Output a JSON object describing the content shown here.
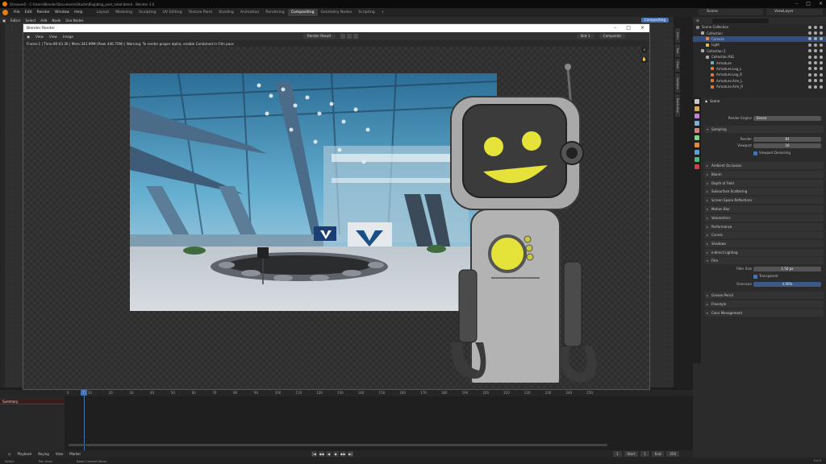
{
  "window": {
    "title": "[Unsaved] - C:\\Users\\Blender\\Documents\\Studio\\Blog\\blog_post_robot.blend - Blender 3.0"
  },
  "topbar": {
    "menus": [
      "File",
      "Edit",
      "Render",
      "Window",
      "Help"
    ],
    "tabs": [
      {
        "label": "Layout",
        "active": false
      },
      {
        "label": "Modeling",
        "active": false
      },
      {
        "label": "Sculpting",
        "active": false
      },
      {
        "label": "UV Editing",
        "active": false
      },
      {
        "label": "Texture Paint",
        "active": false
      },
      {
        "label": "Shading",
        "active": false
      },
      {
        "label": "Animation",
        "active": false
      },
      {
        "label": "Rendering",
        "active": false
      },
      {
        "label": "Compositing",
        "active": true
      },
      {
        "label": "Geometry Nodes",
        "active": false
      },
      {
        "label": "Scripting",
        "active": false
      }
    ],
    "add_tab": "+",
    "scene": "Scene",
    "view_layer": "ViewLayer"
  },
  "node_header": {
    "items": [
      "Editor",
      "Select",
      "Add",
      "Node"
    ],
    "use_nodes": "Use Nodes",
    "right_pill": "Compositing"
  },
  "render_window": {
    "title": "Blender Render",
    "menus": [
      "View",
      "View",
      "Image"
    ],
    "slot": "Render Result",
    "slot_label": "Slot 1",
    "view": "Composite",
    "status": "Frame:1 | Time:00:03.30 | Mem:343.99M (Peak 446.75M) | Warning: To render proper alpha, enable Combined in Film pass",
    "zoom_icon": "zoom-icon"
  },
  "right_tabs": [
    "Item",
    "Tool",
    "View",
    "Options",
    "Backdrop"
  ],
  "outliner": {
    "rows": [
      {
        "label": "Scene Collection",
        "indent": 0,
        "selected": false,
        "color": "#888888"
      },
      {
        "label": "Collection",
        "indent": 1,
        "selected": false,
        "color": "#aaaaaa"
      },
      {
        "label": "Camera",
        "indent": 2,
        "selected": true,
        "color": "#e08a3a"
      },
      {
        "label": "Light",
        "indent": 2,
        "selected": false,
        "color": "#e0c04a"
      },
      {
        "label": "Collection 2",
        "indent": 1,
        "selected": false,
        "color": "#aaaaaa"
      },
      {
        "label": "Collection RIG",
        "indent": 2,
        "selected": false,
        "color": "#aaaaaa"
      },
      {
        "label": "Armature",
        "indent": 3,
        "selected": false,
        "color": "#6ab4b4"
      },
      {
        "label": "Armature.Leg_L",
        "indent": 3,
        "selected": false,
        "color": "#d77a3a"
      },
      {
        "label": "Armature.Leg_R",
        "indent": 3,
        "selected": false,
        "color": "#d77a3a"
      },
      {
        "label": "Armature.Arm_L",
        "indent": 3,
        "selected": false,
        "color": "#d77a3a"
      },
      {
        "label": "Armature.Arm_R",
        "indent": 3,
        "selected": false,
        "color": "#d77a3a"
      }
    ]
  },
  "properties": {
    "crumb": "Scene",
    "render_engine_label": "Render Engine",
    "render_engine": "Eevee",
    "sampling": {
      "title": "Sampling",
      "render_label": "Render",
      "render_value": "64",
      "viewport_label": "Viewport",
      "viewport_value": "16",
      "denoise": "Viewport Denoising"
    },
    "panels": [
      "Ambient Occlusion",
      "Bloom",
      "Depth of Field",
      "Subsurface Scattering",
      "Screen Space Reflections",
      "Motion Blur",
      "Volumetrics",
      "Performance",
      "Curves",
      "Shadows",
      "Indirect Lighting"
    ],
    "film": {
      "title": "Film",
      "filter_label": "Filter Size",
      "filter_value": "1.50 px",
      "transparent": "Transparent",
      "overscan_label": "Overscan",
      "overscan_value": "3.00%"
    },
    "panels_after": [
      "Grease Pencil",
      "Freestyle",
      "Color Management"
    ]
  },
  "timeline": {
    "ticks": [
      "0",
      "10",
      "20",
      "30",
      "40",
      "50",
      "60",
      "70",
      "80",
      "90",
      "100",
      "110",
      "120",
      "130",
      "140",
      "150",
      "160",
      "170",
      "180",
      "190",
      "200",
      "210",
      "220",
      "230",
      "240",
      "250"
    ],
    "current": "1",
    "summary": "Summary",
    "controls": [
      "Playback",
      "Keying",
      "View",
      "Marker"
    ],
    "play_buttons": [
      "|◀",
      "◀◀",
      "◀",
      "▶",
      "▶▶",
      "▶|"
    ],
    "frame_current": "1",
    "start_label": "Start",
    "start": "1",
    "end_label": "End",
    "end": "250"
  },
  "statusbar": {
    "items": [
      "Select",
      "Pan View",
      "Node Context Menu"
    ],
    "version": "3.0.0"
  }
}
